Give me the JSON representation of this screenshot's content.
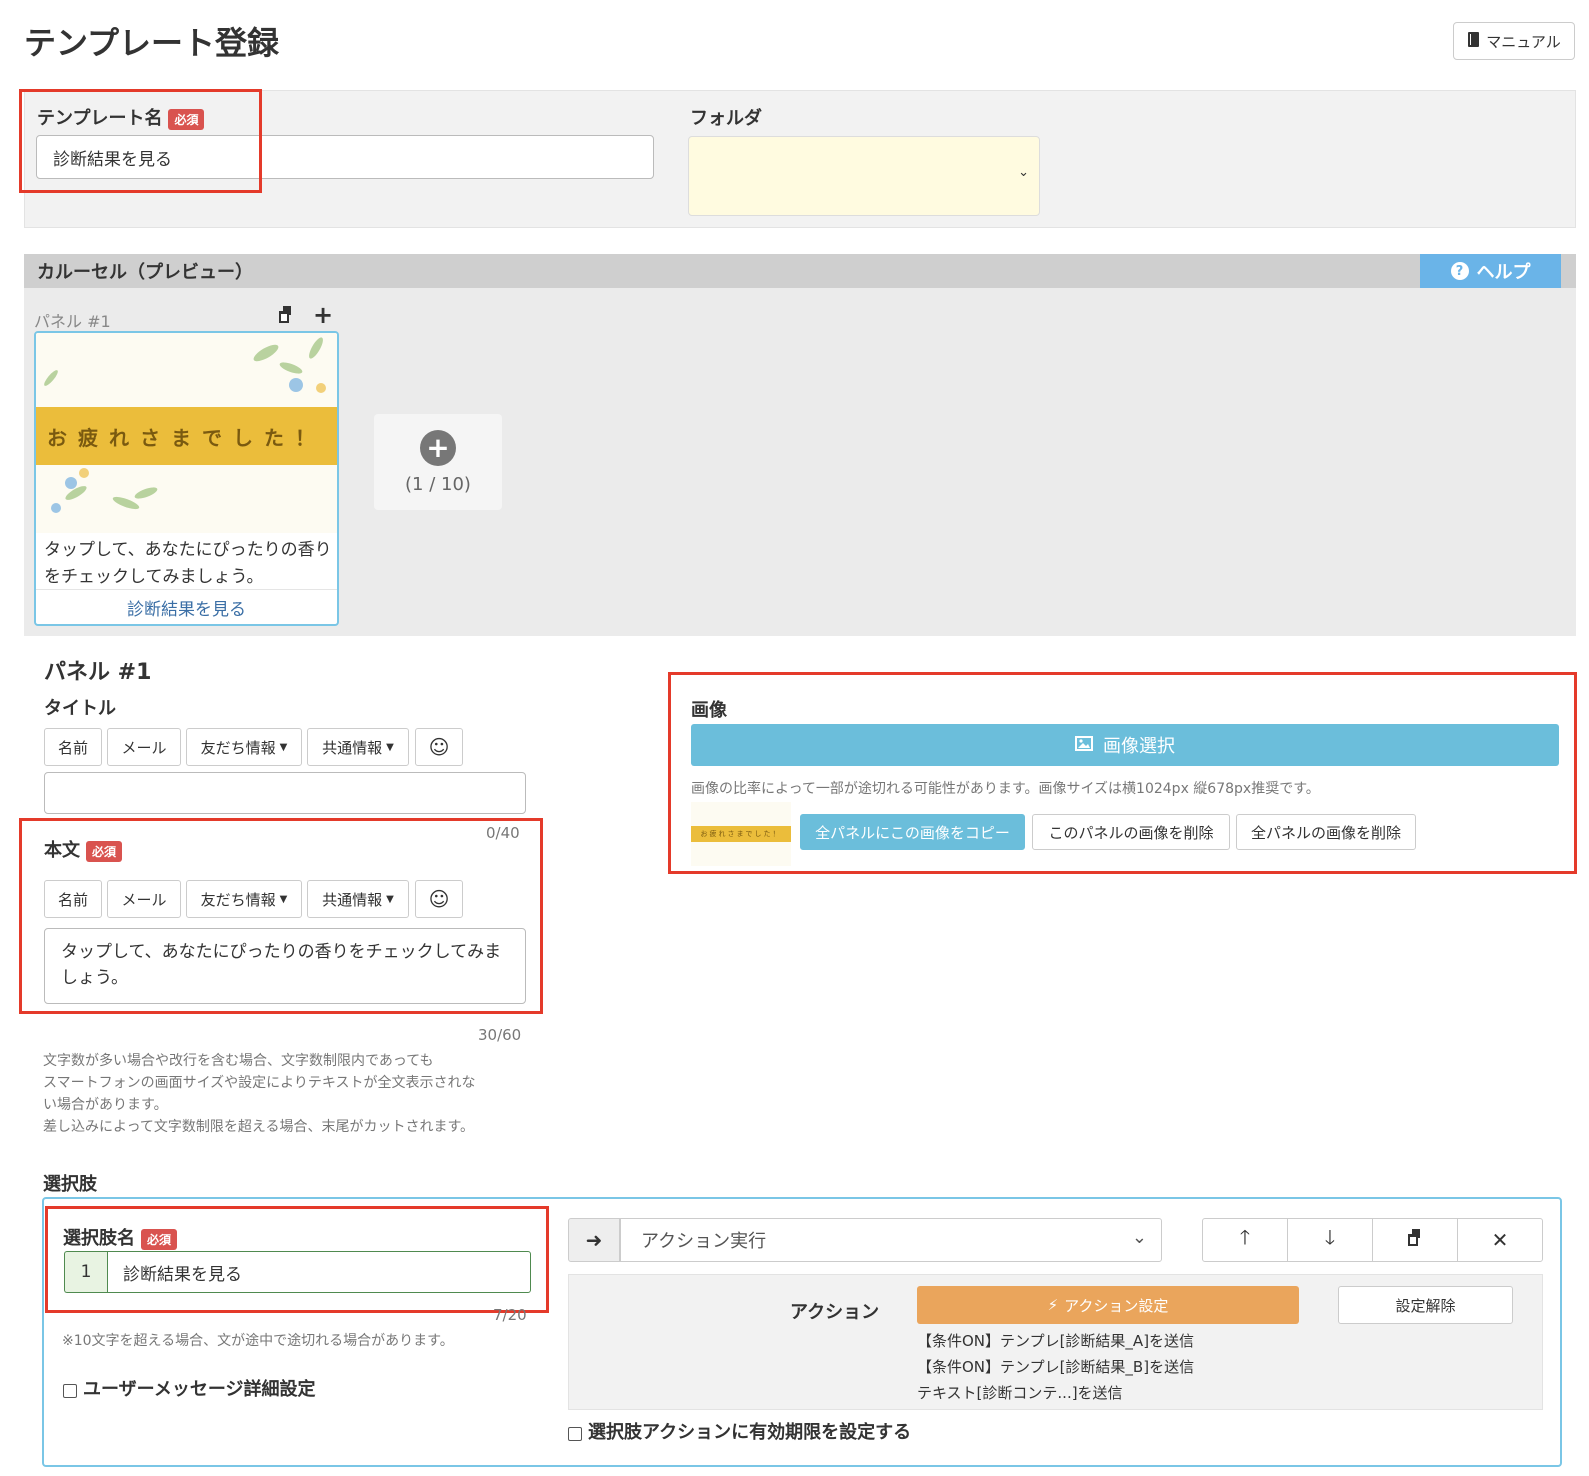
{
  "header": {
    "title": "テンプレート登録",
    "manual_label": "マニュアル"
  },
  "form": {
    "template_name_label": "テンプレート名",
    "required_badge": "必須",
    "template_name_value": "診断結果を見る",
    "folder_label": "フォルダ",
    "folder_value": ""
  },
  "carousel": {
    "title": "カルーセル（プレビュー）",
    "help_label": "ヘルプ",
    "panel_label": "パネル #1",
    "card": {
      "banner_text": "お疲れさまでした！",
      "body": "タップして、あなたにぴったりの香りをチェックしてみましょう。",
      "link": "診断結果を見る"
    },
    "add_counter": "(1 / 10)"
  },
  "panel": {
    "heading": "パネル #1",
    "title_label": "タイトル",
    "title_value": "",
    "title_counter": "0/40",
    "tag_buttons": [
      "名前",
      "メール",
      "友だち情報",
      "共通情報"
    ],
    "body_label": "本文",
    "body_value": "タップして、あなたにぴったりの香りをチェックしてみましょう。",
    "body_counter": "30/60",
    "notes": [
      "文字数が多い場合や改行を含む場合、文字数制限内であっても",
      "スマートフォンの画面サイズや設定によりテキストが全文表示されな",
      "い場合があります。",
      "差し込みによって文字数制限を超える場合、末尾がカットされます。"
    ],
    "image_label": "画像",
    "image_select_label": "画像選択",
    "image_note": "画像の比率によって一部が途切れる可能性があります。画像サイズは横1024px 縦678px推奨です。",
    "copy_all_label": "全パネルにこの画像をコピー",
    "delete_this_label": "このパネルの画像を削除",
    "delete_all_label": "全パネルの画像を削除",
    "thumb_text": "お疲れさまでした！"
  },
  "choices": {
    "section_label": "選択肢",
    "name_label": "選択肢名",
    "index": "1",
    "name_value": "診断結果を見る",
    "name_counter": "7/20",
    "name_note": "※10文字を超える場合、文が途中で途切れる場合があります。",
    "user_msg_label": "ユーザーメッセージ詳細設定",
    "action_type": "アクション実行",
    "action_label": "アクション",
    "action_set_label": "アクション設定",
    "unset_label": "設定解除",
    "action_lines": [
      "【条件ON】テンプレ[診断結果_A]を送信",
      "【条件ON】テンプレ[診断結果_B]を送信",
      "テキスト[診断コンテ...]を送信"
    ],
    "expiry_label": "選択肢アクションに有効期限を設定する"
  },
  "colors": {
    "accent_blue": "#6bbedb",
    "action_orange": "#eaa55c",
    "required_red": "#d9534f",
    "highlight_red": "#e43a2a"
  }
}
